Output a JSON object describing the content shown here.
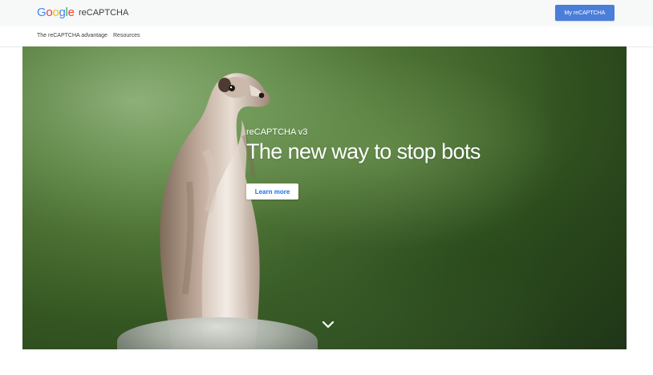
{
  "header": {
    "logo": {
      "letters": [
        "G",
        "o",
        "o",
        "g",
        "l",
        "e"
      ],
      "colors": [
        "#4285F4",
        "#EA4335",
        "#FBBC05",
        "#4285F4",
        "#34A853",
        "#EA4335"
      ]
    },
    "product_name": "reCAPTCHA",
    "cta_label": "My reCAPTCHA",
    "cta_color": "#4A7ED9"
  },
  "subnav": {
    "items": [
      {
        "label": "The reCAPTCHA advantage"
      },
      {
        "label": "Resources"
      }
    ]
  },
  "hero": {
    "eyebrow": "reCAPTCHA v3",
    "title": "The new way to stop bots",
    "button_label": "Learn more",
    "icons": {
      "scroll_down": "chevron-down-icon"
    }
  }
}
